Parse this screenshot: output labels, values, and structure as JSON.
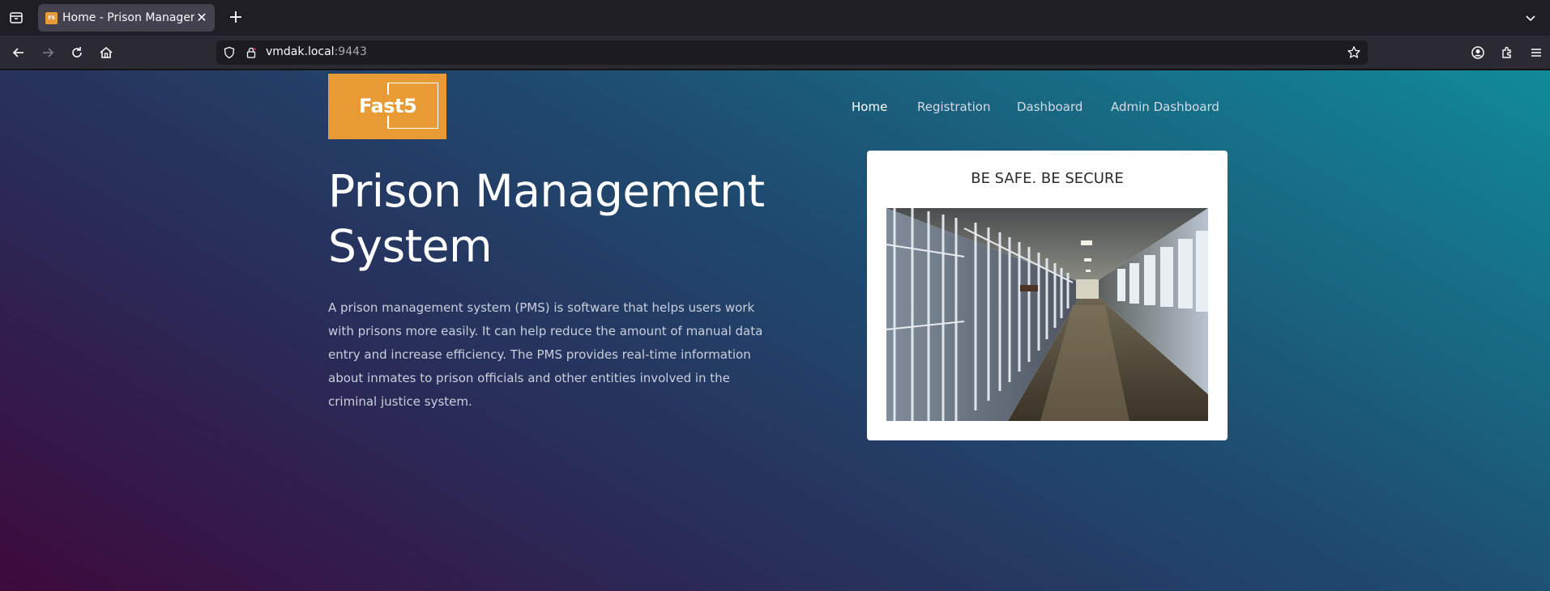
{
  "browser": {
    "tab_title": "Home - Prison Management System",
    "favicon_text": "F5",
    "url_host": "vmdak.local",
    "url_port": ":9443"
  },
  "site": {
    "logo_text": "Fast5",
    "nav": [
      {
        "label": "Home",
        "active": true
      },
      {
        "label": "Registration",
        "active": false
      },
      {
        "label": "Dashboard",
        "active": false
      },
      {
        "label": "Admin Dashboard",
        "active": false
      }
    ],
    "hero": {
      "title": "Prison Management System",
      "description": "A prison management system (PMS) is software that helps users work with prisons more easily. It can help reduce the amount of manual data entry and increase efficiency. The PMS provides real-time information about inmates to prison officials and other entities involved in the criminal justice system."
    },
    "card": {
      "title": "BE SAFE. BE SECURE",
      "image": "prison-corridor-photo"
    }
  },
  "colors": {
    "logo_bg": "#e89b35",
    "gradient_start": "#3d0a3c",
    "gradient_end": "#108b98"
  }
}
